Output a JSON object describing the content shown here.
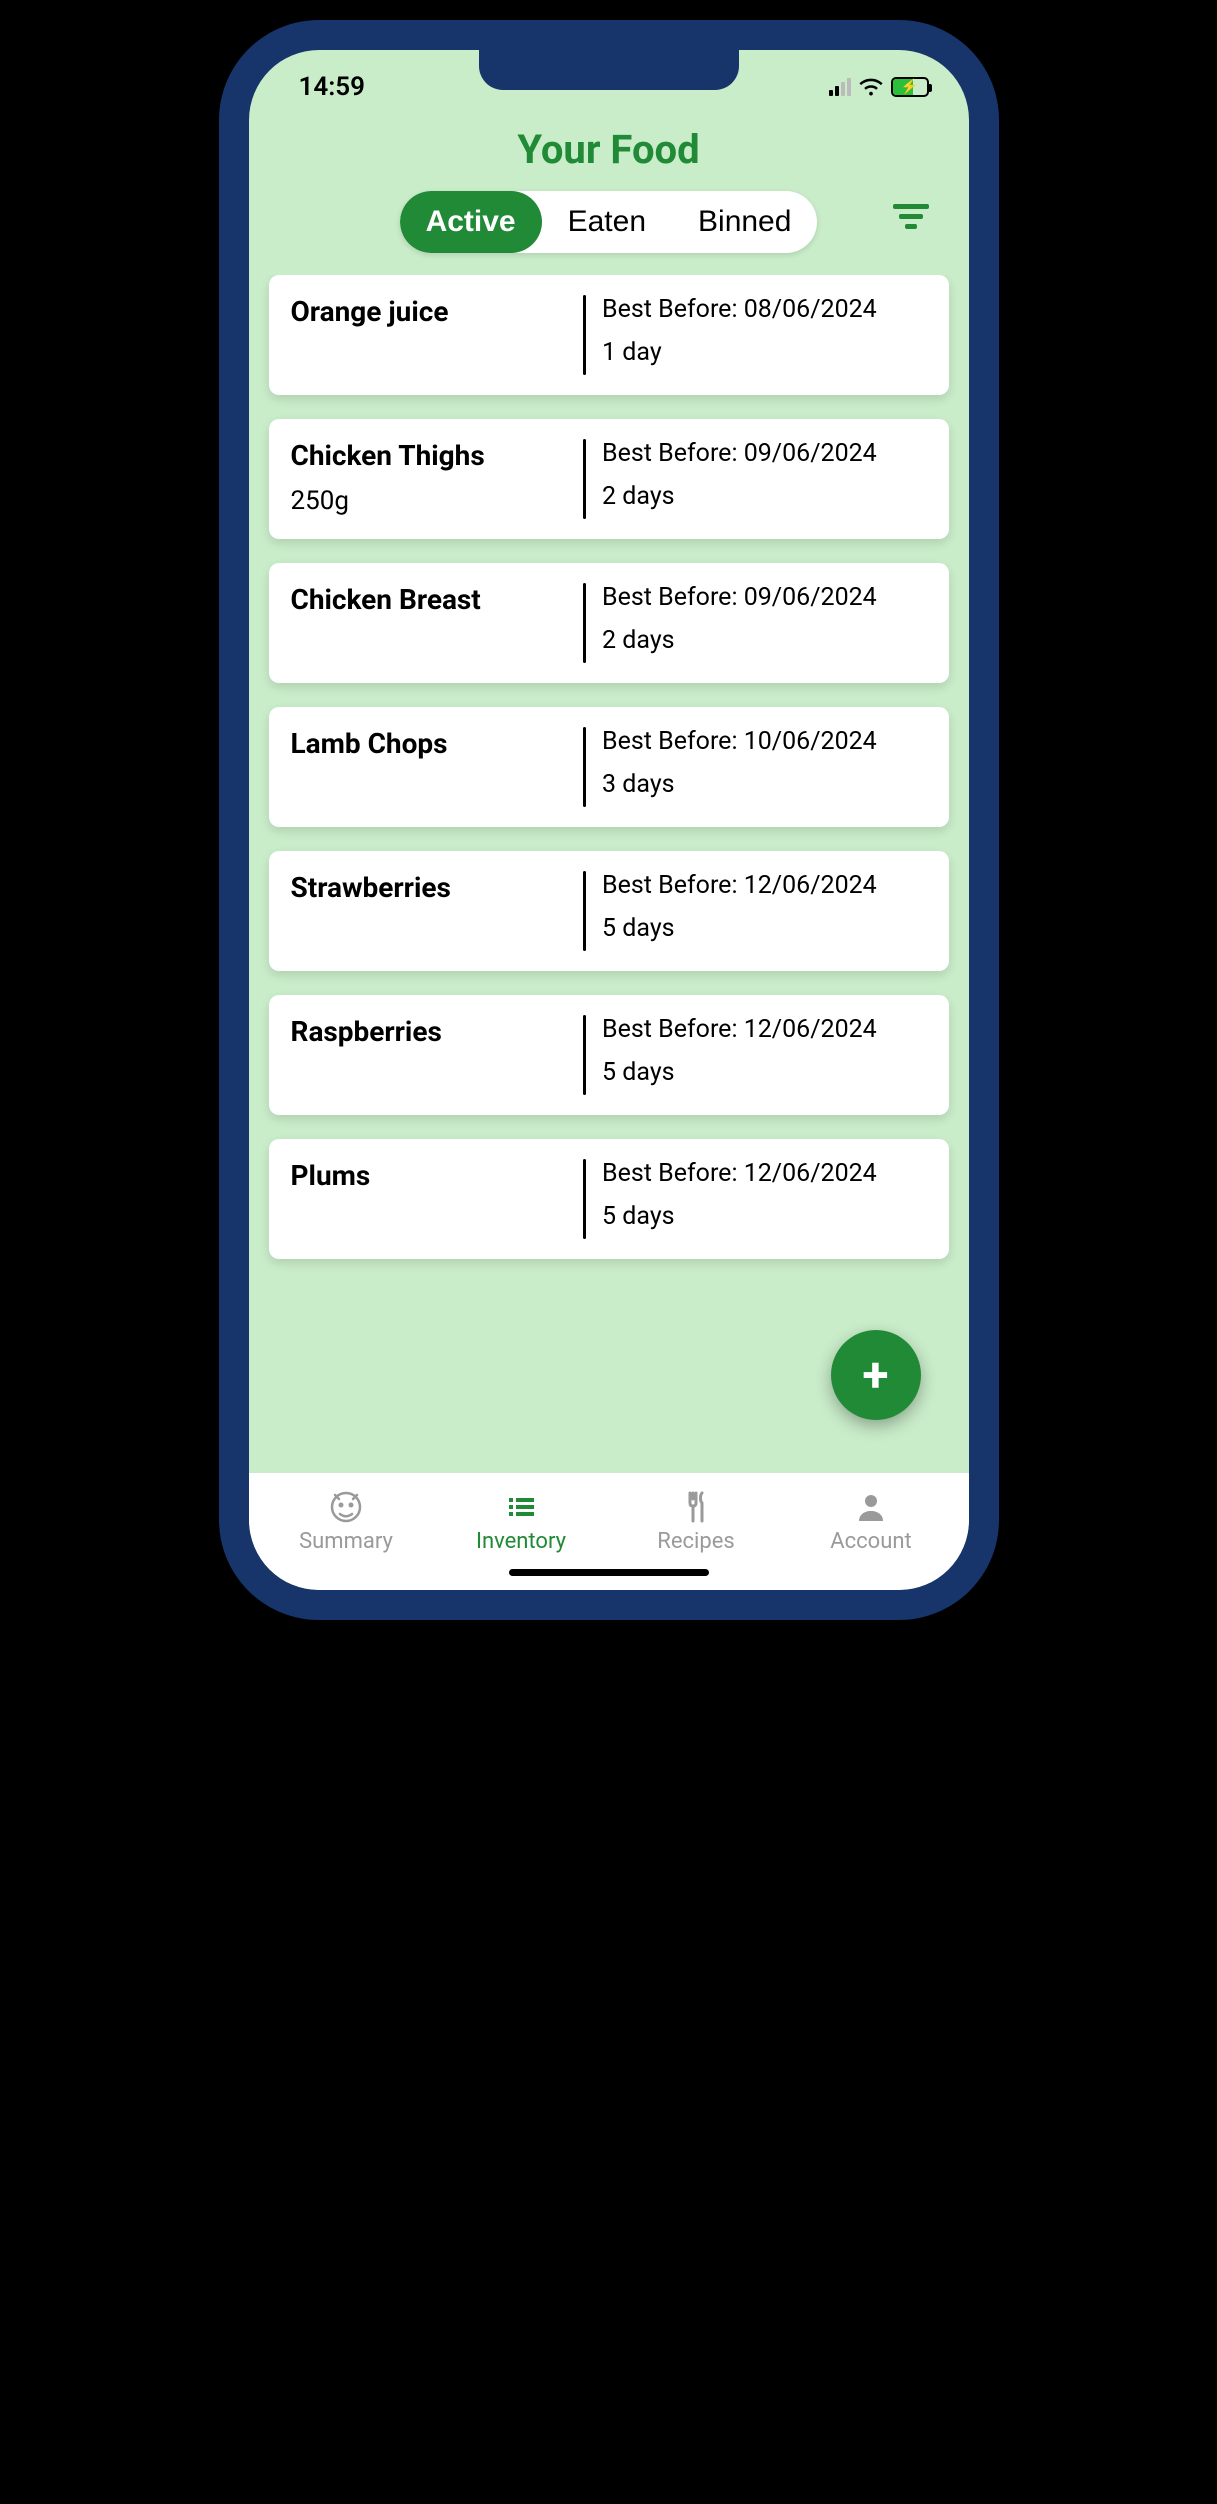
{
  "status": {
    "time": "14:59"
  },
  "header": {
    "title": "Your Food",
    "tabs": [
      {
        "label": "Active",
        "active": true
      },
      {
        "label": "Eaten",
        "active": false
      },
      {
        "label": "Binned",
        "active": false
      }
    ]
  },
  "best_before_label": "Best Before: ",
  "items": [
    {
      "name": "Orange juice",
      "quantity": "",
      "best_before": "08/06/2024",
      "days": "1 day"
    },
    {
      "name": "Chicken Thighs",
      "quantity": "250g",
      "best_before": "09/06/2024",
      "days": "2 days"
    },
    {
      "name": "Chicken Breast",
      "quantity": "",
      "best_before": "09/06/2024",
      "days": "2 days"
    },
    {
      "name": "Lamb Chops",
      "quantity": "",
      "best_before": "10/06/2024",
      "days": "3 days"
    },
    {
      "name": "Strawberries",
      "quantity": "",
      "best_before": "12/06/2024",
      "days": "5 days"
    },
    {
      "name": "Raspberries",
      "quantity": "",
      "best_before": "12/06/2024",
      "days": "5 days"
    },
    {
      "name": "Plums",
      "quantity": "",
      "best_before": "12/06/2024",
      "days": "5 days"
    }
  ],
  "fab": {
    "label": "+"
  },
  "tabbar": [
    {
      "label": "Summary",
      "active": false
    },
    {
      "label": "Inventory",
      "active": true
    },
    {
      "label": "Recipes",
      "active": false
    },
    {
      "label": "Account",
      "active": false
    }
  ]
}
